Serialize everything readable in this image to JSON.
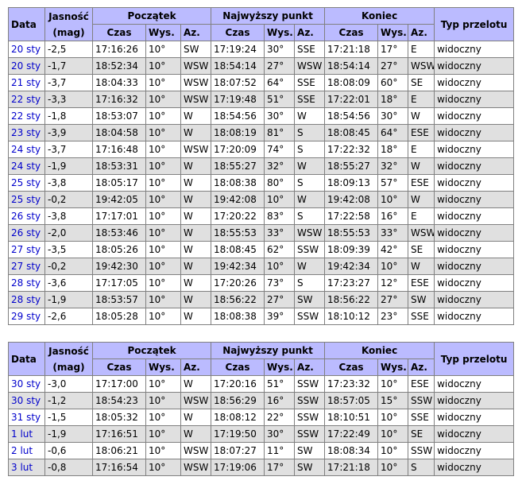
{
  "headers": {
    "date": "Data",
    "mag_line1": "Jasność",
    "mag_line2": "(mag)",
    "start": "Początek",
    "max": "Najwyższy punkt",
    "end": "Koniec",
    "type": "Typ przelotu",
    "time": "Czas",
    "alt": "Wys.",
    "az": "Az."
  },
  "table1": [
    [
      "20 sty",
      "-2,5",
      "17:16:26",
      "10°",
      "SW",
      "17:19:24",
      "30°",
      "SSE",
      "17:21:18",
      "17°",
      "E",
      "widoczny"
    ],
    [
      "20 sty",
      "-1,7",
      "18:52:34",
      "10°",
      "WSW",
      "18:54:14",
      "27°",
      "WSW",
      "18:54:14",
      "27°",
      "WSW",
      "widoczny"
    ],
    [
      "21 sty",
      "-3,7",
      "18:04:33",
      "10°",
      "WSW",
      "18:07:52",
      "64°",
      "SSE",
      "18:08:09",
      "60°",
      "SE",
      "widoczny"
    ],
    [
      "22 sty",
      "-3,3",
      "17:16:32",
      "10°",
      "WSW",
      "17:19:48",
      "51°",
      "SSE",
      "17:22:01",
      "18°",
      "E",
      "widoczny"
    ],
    [
      "22 sty",
      "-1,8",
      "18:53:07",
      "10°",
      "W",
      "18:54:56",
      "30°",
      "W",
      "18:54:56",
      "30°",
      "W",
      "widoczny"
    ],
    [
      "23 sty",
      "-3,9",
      "18:04:58",
      "10°",
      "W",
      "18:08:19",
      "81°",
      "S",
      "18:08:45",
      "64°",
      "ESE",
      "widoczny"
    ],
    [
      "24 sty",
      "-3,7",
      "17:16:48",
      "10°",
      "WSW",
      "17:20:09",
      "74°",
      "S",
      "17:22:32",
      "18°",
      "E",
      "widoczny"
    ],
    [
      "24 sty",
      "-1,9",
      "18:53:31",
      "10°",
      "W",
      "18:55:27",
      "32°",
      "W",
      "18:55:27",
      "32°",
      "W",
      "widoczny"
    ],
    [
      "25 sty",
      "-3,8",
      "18:05:17",
      "10°",
      "W",
      "18:08:38",
      "80°",
      "S",
      "18:09:13",
      "57°",
      "ESE",
      "widoczny"
    ],
    [
      "25 sty",
      "-0,2",
      "19:42:05",
      "10°",
      "W",
      "19:42:08",
      "10°",
      "W",
      "19:42:08",
      "10°",
      "W",
      "widoczny"
    ],
    [
      "26 sty",
      "-3,8",
      "17:17:01",
      "10°",
      "W",
      "17:20:22",
      "83°",
      "S",
      "17:22:58",
      "16°",
      "E",
      "widoczny"
    ],
    [
      "26 sty",
      "-2,0",
      "18:53:46",
      "10°",
      "W",
      "18:55:53",
      "33°",
      "WSW",
      "18:55:53",
      "33°",
      "WSW",
      "widoczny"
    ],
    [
      "27 sty",
      "-3,5",
      "18:05:26",
      "10°",
      "W",
      "18:08:45",
      "62°",
      "SSW",
      "18:09:39",
      "42°",
      "SE",
      "widoczny"
    ],
    [
      "27 sty",
      "-0,2",
      "19:42:30",
      "10°",
      "W",
      "19:42:34",
      "10°",
      "W",
      "19:42:34",
      "10°",
      "W",
      "widoczny"
    ],
    [
      "28 sty",
      "-3,6",
      "17:17:05",
      "10°",
      "W",
      "17:20:26",
      "73°",
      "S",
      "17:23:27",
      "12°",
      "ESE",
      "widoczny"
    ],
    [
      "28 sty",
      "-1,9",
      "18:53:57",
      "10°",
      "W",
      "18:56:22",
      "27°",
      "SW",
      "18:56:22",
      "27°",
      "SW",
      "widoczny"
    ],
    [
      "29 sty",
      "-2,6",
      "18:05:28",
      "10°",
      "W",
      "18:08:38",
      "39°",
      "SSW",
      "18:10:12",
      "23°",
      "SSE",
      "widoczny"
    ]
  ],
  "table2": [
    [
      "30 sty",
      "-3,0",
      "17:17:00",
      "10°",
      "W",
      "17:20:16",
      "51°",
      "SSW",
      "17:23:32",
      "10°",
      "ESE",
      "widoczny"
    ],
    [
      "30 sty",
      "-1,2",
      "18:54:23",
      "10°",
      "WSW",
      "18:56:29",
      "16°",
      "SSW",
      "18:57:05",
      "15°",
      "SSW",
      "widoczny"
    ],
    [
      "31 sty",
      "-1,5",
      "18:05:32",
      "10°",
      "W",
      "18:08:12",
      "22°",
      "SSW",
      "18:10:51",
      "10°",
      "SSE",
      "widoczny"
    ],
    [
      "1 lut",
      "-1,9",
      "17:16:51",
      "10°",
      "W",
      "17:19:50",
      "30°",
      "SSW",
      "17:22:49",
      "10°",
      "SE",
      "widoczny"
    ],
    [
      "2 lut",
      "-0,6",
      "18:06:21",
      "10°",
      "WSW",
      "18:07:27",
      "11°",
      "SW",
      "18:08:34",
      "10°",
      "SSW",
      "widoczny"
    ],
    [
      "3 lut",
      "-0,8",
      "17:16:54",
      "10°",
      "WSW",
      "17:19:06",
      "17°",
      "SW",
      "17:21:18",
      "10°",
      "S",
      "widoczny"
    ]
  ]
}
